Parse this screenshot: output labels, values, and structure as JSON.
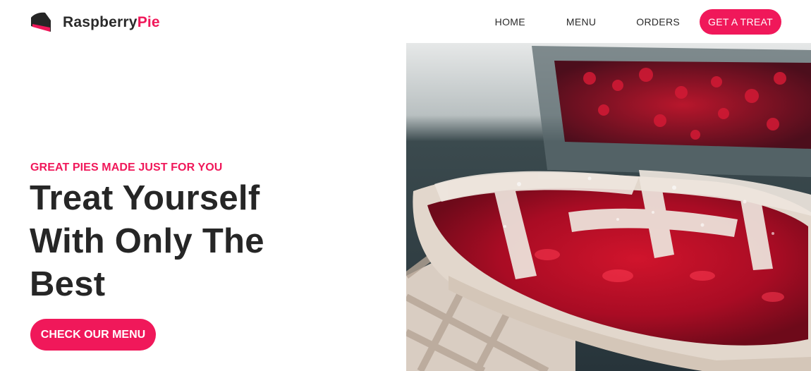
{
  "brand": {
    "name_part1": "Raspberry",
    "name_part2": "Pie",
    "logo_icon": "pie-slice-icon",
    "accent_color": "#f0185a",
    "text_color": "#262626"
  },
  "nav": {
    "items": [
      {
        "label": "HOME"
      },
      {
        "label": "MENU"
      },
      {
        "label": "ORDERS"
      }
    ],
    "cta_label": "GET A TREAT"
  },
  "hero": {
    "eyebrow": "GREAT PIES MADE JUST FOR YOU",
    "headline_lines": [
      "Treat Yourself",
      "With Only The",
      "Best"
    ],
    "cta_label": "CHECK OUR MENU",
    "image_subject": "raspberry-pie-photo"
  }
}
